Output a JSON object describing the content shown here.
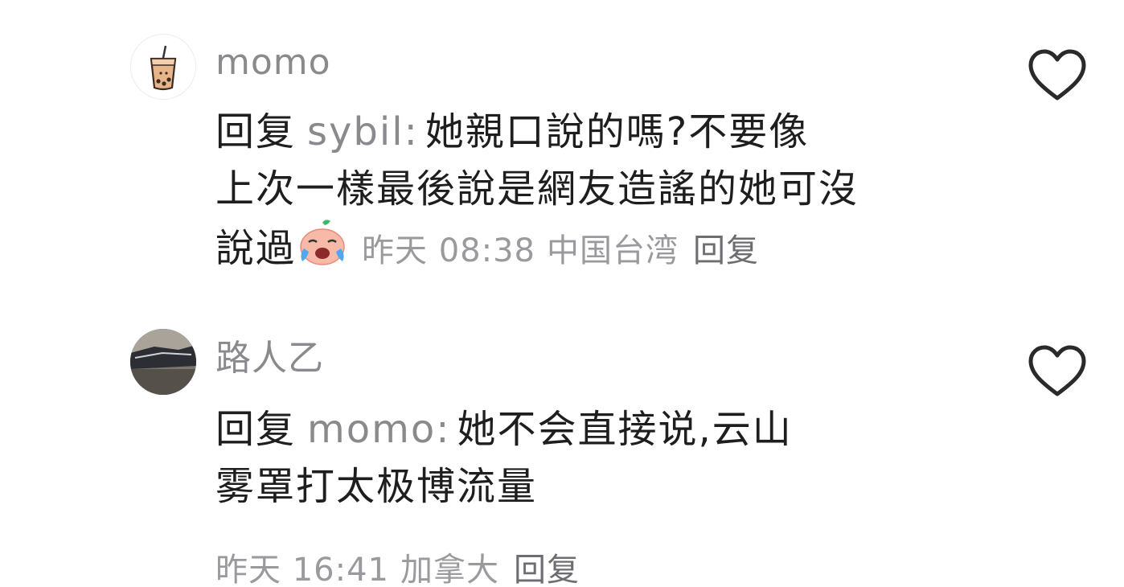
{
  "comments": [
    {
      "username": "momo",
      "reply_prefix": "回复",
      "reply_target": "sybil",
      "colon": ":",
      "text_line1": "她親口說的嗎?不要像",
      "text_line2": "上次一樣最後說是網友造謠的她可沒",
      "text_line3": "說過",
      "emoji": "crying-face-emoji",
      "time": "昨天 08:38",
      "location": "中国台湾",
      "reply_label": "回复"
    },
    {
      "username": "路人乙",
      "reply_prefix": "回复",
      "reply_target": "momo",
      "colon": ":",
      "text_line1": "她不会直接说,云山",
      "text_line2": "雾罩打太极博流量",
      "time": "昨天 16:41",
      "location": "加拿大",
      "reply_label": "回复"
    }
  ],
  "colors": {
    "text": "#1e1e1e",
    "secondary": "#8a8a8e",
    "heart": "#2a2a2a"
  }
}
